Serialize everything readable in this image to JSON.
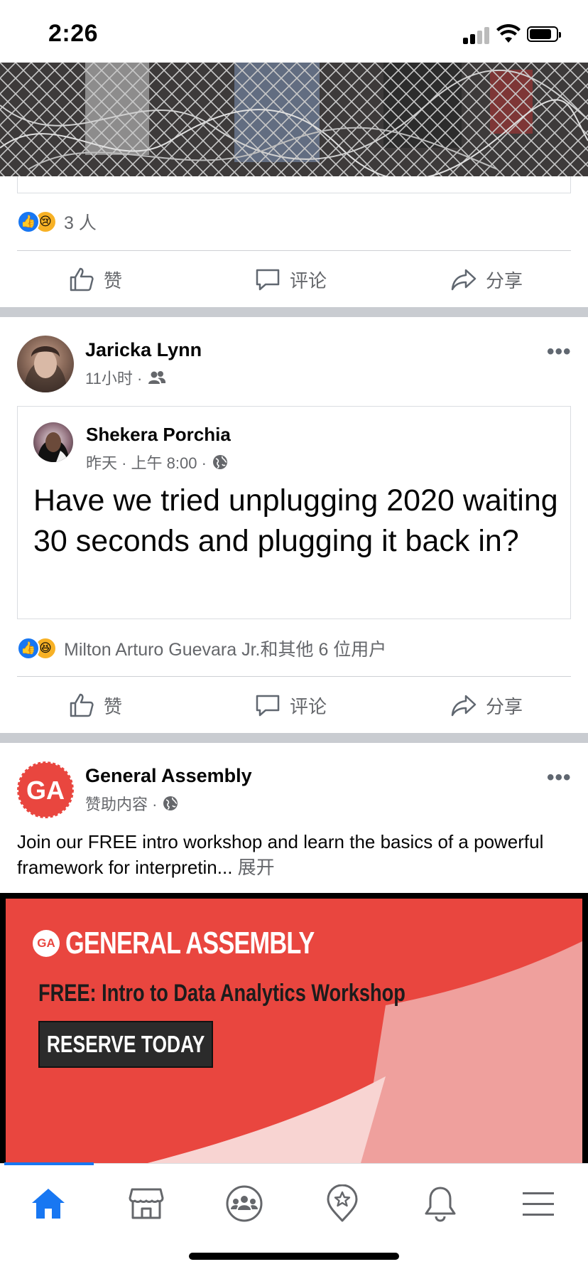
{
  "status_bar": {
    "time": "2:26"
  },
  "post1": {
    "reaction_count": "3 人",
    "actions": {
      "like": "赞",
      "comment": "评论",
      "share": "分享"
    }
  },
  "post2": {
    "author": "Jaricka Lynn",
    "time": "11小时 ·",
    "audience_icon": "friends-icon",
    "shared": {
      "author": "Shekera Porchia",
      "time": "昨天 · 上午 8:00 ·",
      "audience_icon": "globe-icon",
      "text": "Have we tried unplugging 2020 waiting 30 seconds and plugging it back in?"
    },
    "reaction_summary": "Milton Arturo Guevara Jr.和其他 6 位用户",
    "actions": {
      "like": "赞",
      "comment": "评论",
      "share": "分享"
    }
  },
  "post3": {
    "author": "General Assembly",
    "avatar_text": "GA",
    "meta": "赞助内容 ·",
    "text": "Join our FREE intro workshop and learn the basics of a powerful framework for interpretin...",
    "see_more": "展开",
    "ad": {
      "logo_text": "GA",
      "brand": "GENERAL ASSEMBLY",
      "headline": "FREE: Intro to Data Analytics Workshop",
      "cta": "RESERVE TODAY"
    }
  },
  "bottom_nav": {
    "items": [
      "home-icon",
      "marketplace-icon",
      "groups-icon",
      "watch-icon",
      "notifications-icon",
      "menu-icon"
    ],
    "active": "home-icon",
    "accent": "#1877f2"
  }
}
